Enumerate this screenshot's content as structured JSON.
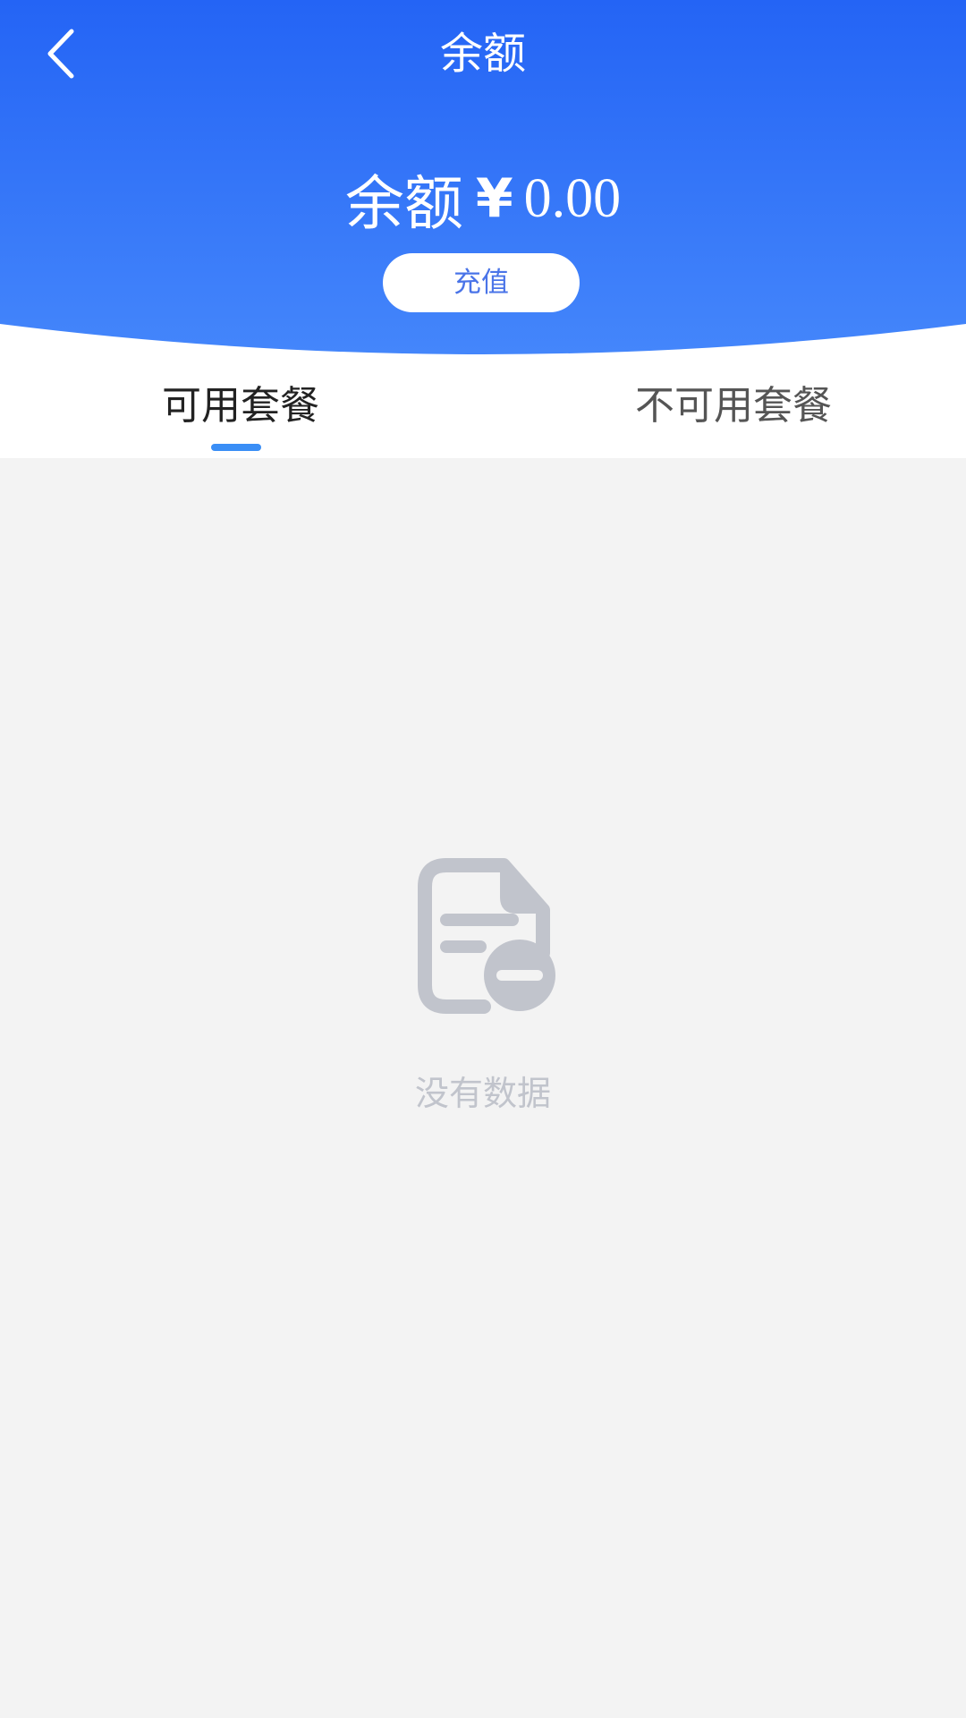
{
  "header": {
    "title": "余额",
    "back_icon": "chevron-left-icon",
    "gradient_top": "#2464f5",
    "gradient_bottom": "#4184fb"
  },
  "balance": {
    "label": "余额",
    "currency": "¥",
    "amount": "0.00"
  },
  "recharge_button": {
    "label": "充值",
    "text_color": "#4a74e8"
  },
  "tabs": {
    "items": [
      {
        "label": "可用套餐",
        "active": true
      },
      {
        "label": "不可用套餐",
        "active": false
      }
    ],
    "indicator_color": "#3a8ef6"
  },
  "empty_state": {
    "icon": "document-minus-icon",
    "text": "没有数据",
    "color": "#c1c4cc"
  },
  "colors": {
    "page_background": "#f3f3f3",
    "surface": "#ffffff"
  }
}
